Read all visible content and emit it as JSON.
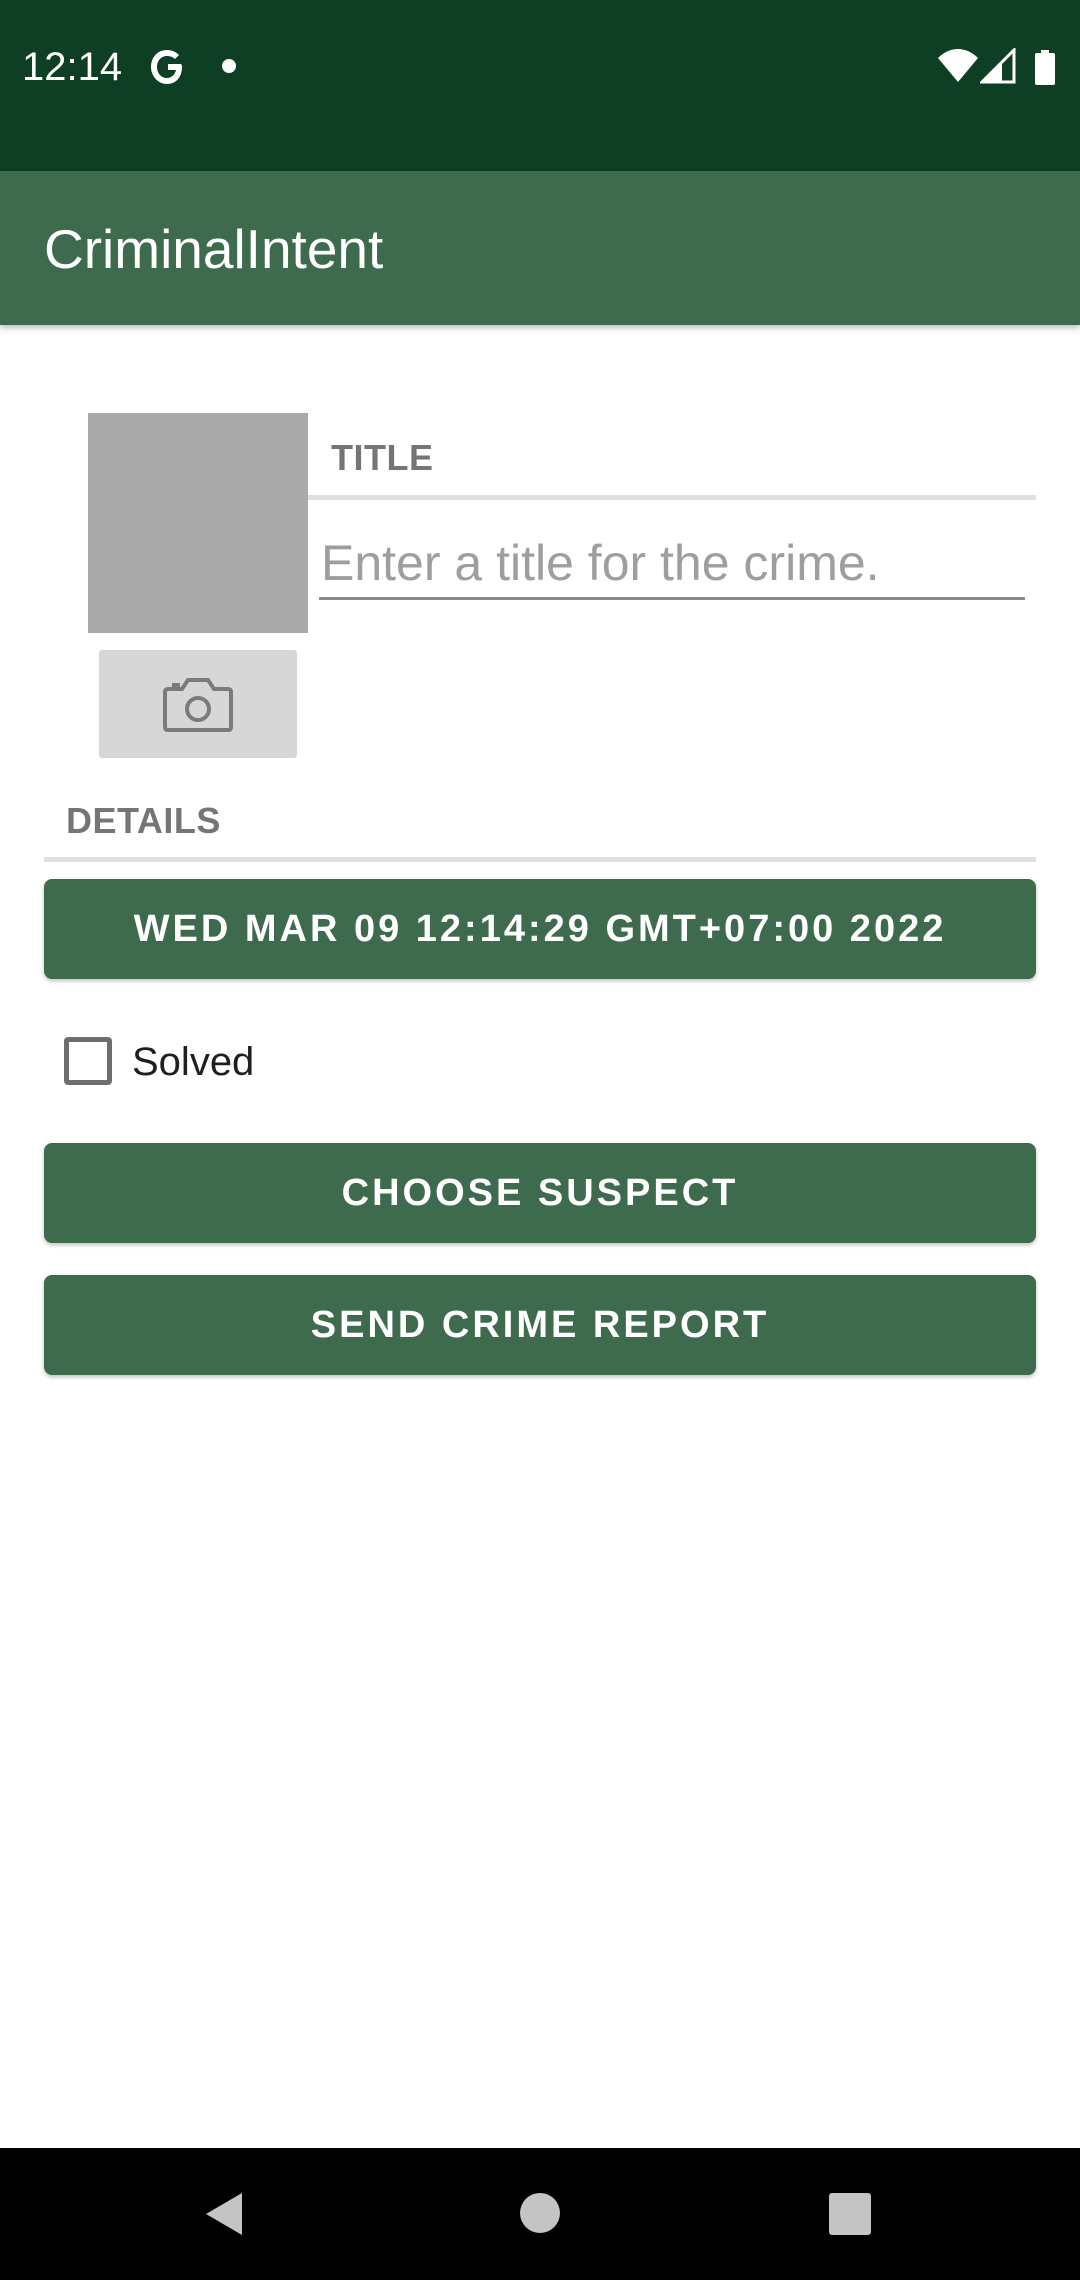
{
  "status_bar": {
    "time": "12:14",
    "icons": [
      "google-icon",
      "notification-dot-icon",
      "wifi-icon",
      "signal-icon",
      "battery-icon"
    ],
    "background_color": "#0e3f25"
  },
  "app_bar": {
    "title": "CriminalIntent",
    "background_color": "#3e6b4e"
  },
  "photo": {
    "placeholder_color": "#aaaaaa",
    "camera_button_icon": "camera-icon"
  },
  "title_section": {
    "label": "TITLE",
    "input_value": "",
    "input_placeholder": "Enter a title for the crime."
  },
  "details_section": {
    "label": "DETAILS",
    "date_button_label": "WED MAR 09 12:14:29 GMT+07:00 2022",
    "solved": {
      "label": "Solved",
      "checked": false
    },
    "choose_suspect_label": "CHOOSE SUSPECT",
    "send_report_label": "SEND CRIME REPORT"
  },
  "nav_bar": {
    "icons": [
      "back-icon",
      "home-icon",
      "recents-icon"
    ]
  }
}
